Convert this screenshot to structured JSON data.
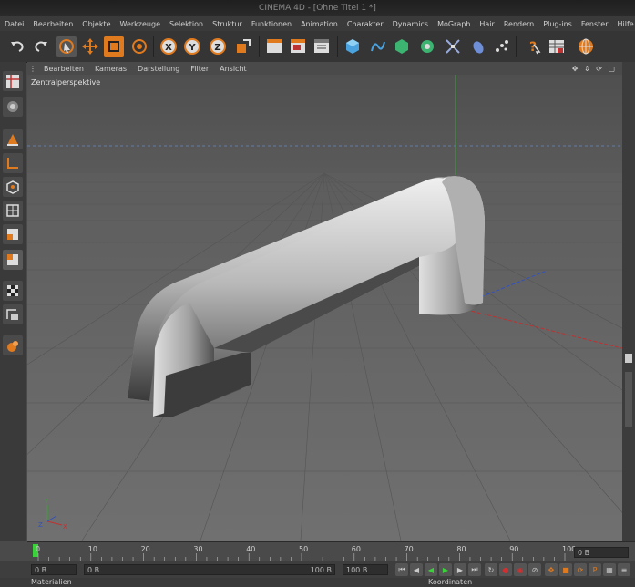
{
  "window": {
    "title": "CINEMA 4D - [Ohne Titel 1 *]"
  },
  "menu": [
    "Datei",
    "Bearbeiten",
    "Objekte",
    "Werkzeuge",
    "Selektion",
    "Struktur",
    "Funktionen",
    "Animation",
    "Charakter",
    "Dynamics",
    "MoGraph",
    "Hair",
    "Rendern",
    "Plug-ins",
    "Fenster",
    "Hilfe"
  ],
  "toolbar": {
    "tools": [
      "undo-icon",
      "redo-icon",
      "live-selection-icon",
      "move-icon",
      "scale-icon",
      "rotate-icon",
      "x-axis-icon",
      "y-axis-icon",
      "z-axis-icon",
      "world-coord-icon",
      "render-view-icon",
      "render-picture-viewer-icon",
      "render-settings-icon",
      "cube-icon",
      "spline-icon",
      "nurbs-icon",
      "array-icon",
      "deformer-icon",
      "environment-icon",
      "particles-icon",
      "camera-icon",
      "light-icon",
      "scene-icon"
    ],
    "axis_labels": {
      "x": "X",
      "y": "Y",
      "z": "Z"
    }
  },
  "viewport": {
    "menu": [
      "Bearbeiten",
      "Kameras",
      "Darstellung",
      "Filter",
      "Ansicht"
    ],
    "label": "Zentralperspektive",
    "axis_labels": {
      "y": "Y",
      "x": "X",
      "z": "Z"
    }
  },
  "timeline": {
    "ticks": [
      "0",
      "10",
      "20",
      "30",
      "40",
      "50",
      "60",
      "70",
      "80",
      "90",
      "100"
    ],
    "current_frame": "0 B"
  },
  "controls": {
    "start_field": "0 B",
    "end_field": "100 B",
    "min_field": "0 B",
    "max_field": "100 B"
  },
  "status": {
    "left": "Materialien",
    "right": "Koordinaten"
  },
  "colors": {
    "background": "#4a4a4a",
    "floor": "#6e6e6e",
    "accent": "#e07a1f"
  }
}
